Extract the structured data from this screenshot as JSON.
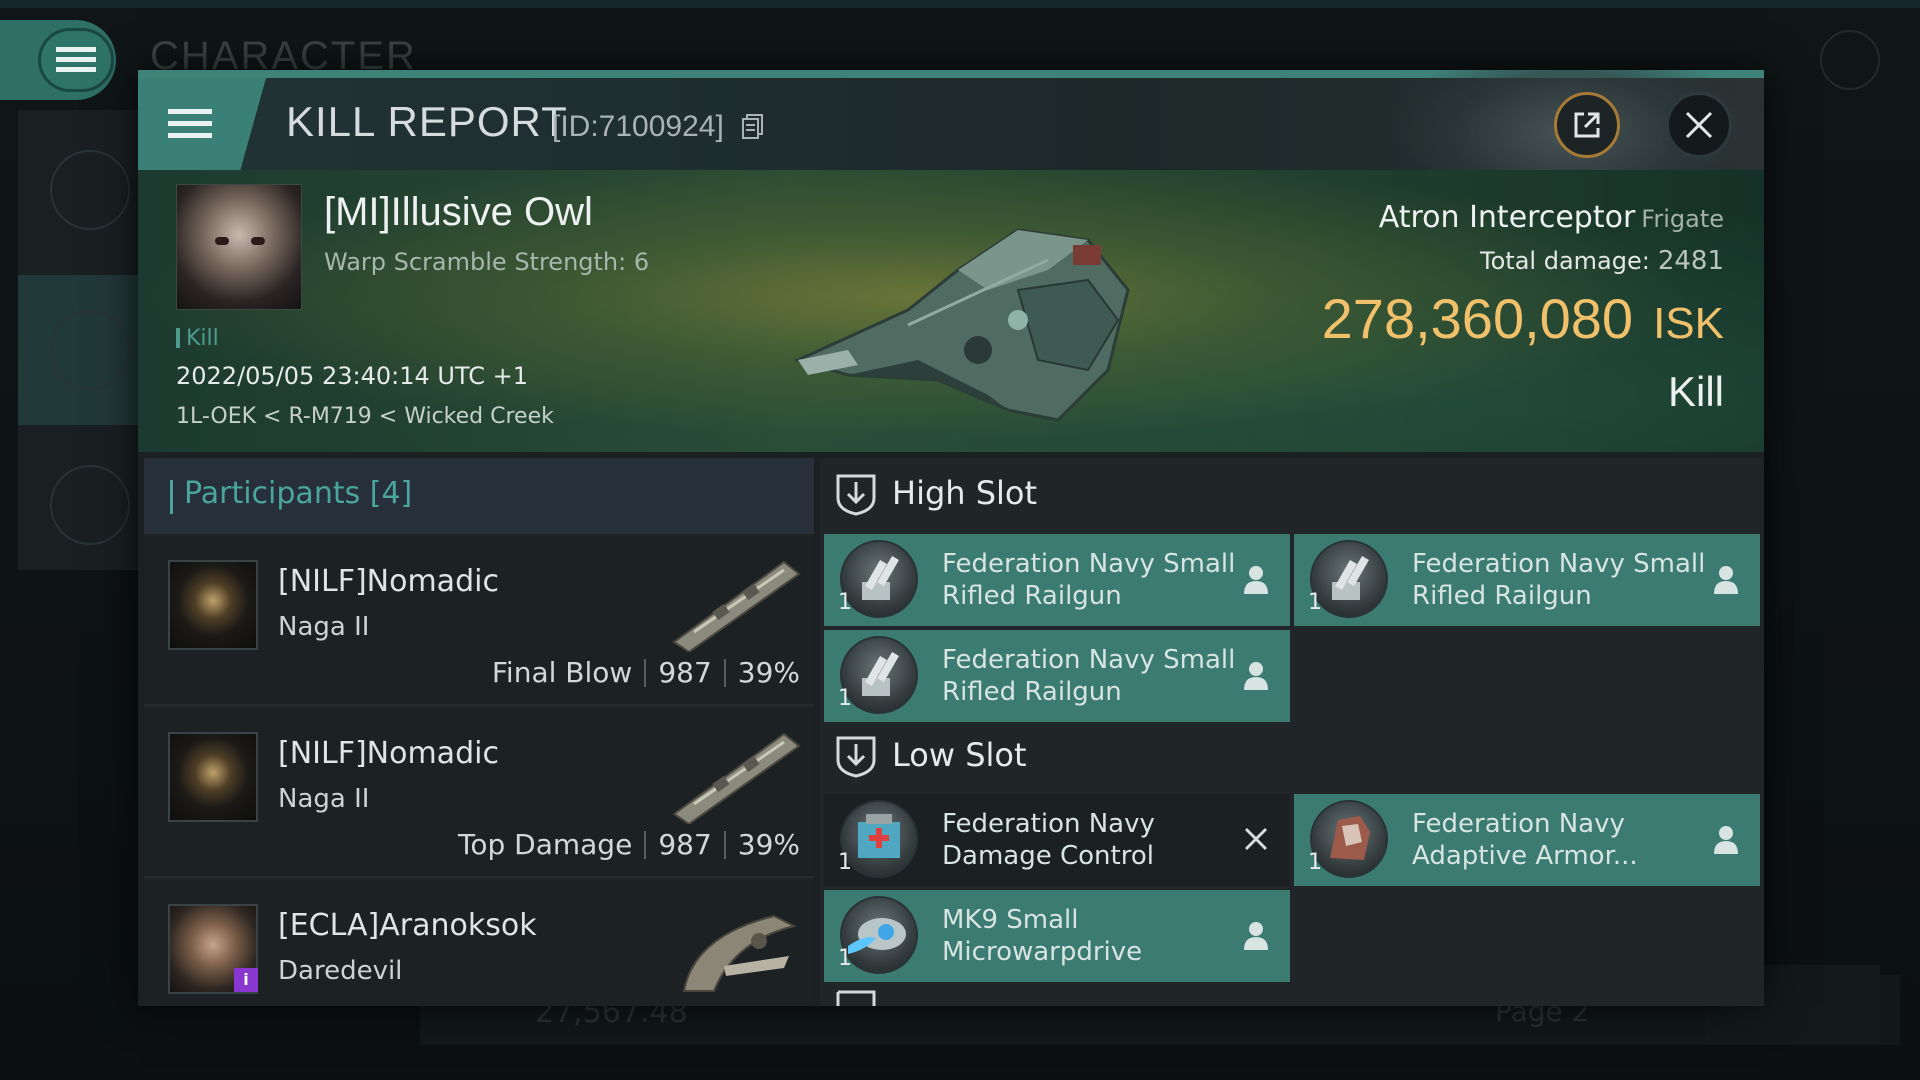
{
  "background": {
    "title": "CHARACTER",
    "bottom_text": "27,567.48",
    "page_label": "Page 2"
  },
  "header": {
    "title": "KILL REPORT",
    "id": "[ID:7100924]"
  },
  "victim": {
    "name": "[MI]Illusive Owl",
    "detail": "Warp Scramble Strength: 6",
    "kill_tag": "Kill",
    "datetime": "2022/05/05 23:40:14 UTC +1",
    "location": "1L-OEK < R-M719 < Wicked Creek",
    "ship_name": "Atron Interceptor",
    "ship_class": "Frigate",
    "damage_label": "Total damage:",
    "damage_value": "2481",
    "isk_value": "278,360,080",
    "isk_unit": "ISK",
    "result": "Kill"
  },
  "participants": {
    "title": "Participants [4]",
    "rows": [
      {
        "name": "[NILF]Nomadic",
        "ship": "Naga II",
        "role": "Final Blow",
        "damage": "987",
        "percent": "39%"
      },
      {
        "name": "[NILF]Nomadic",
        "ship": "Naga II",
        "role": "Top Damage",
        "damage": "987",
        "percent": "39%"
      },
      {
        "name": "[ECLA]Aranoksok",
        "ship": "Daredevil",
        "badge": "i"
      }
    ]
  },
  "slots": {
    "high": {
      "title": "High Slot",
      "modules": [
        {
          "qty": "1",
          "name": "Federation Navy Small Rifled Railgun",
          "status": "dropped"
        },
        {
          "qty": "1",
          "name": "Federation Navy Small Rifled Railgun",
          "status": "dropped"
        },
        {
          "qty": "1",
          "name": "Federation Navy Small Rifled Railgun",
          "status": "dropped"
        }
      ]
    },
    "low": {
      "title": "Low Slot",
      "modules": [
        {
          "qty": "1",
          "name": "Federation Navy Damage Control",
          "status": "destroyed"
        },
        {
          "qty": "1",
          "name": "Federation Navy Adaptive Armor...",
          "status": "dropped"
        },
        {
          "qty": "1",
          "name": "MK9 Small Microwarpdrive",
          "status": "dropped"
        }
      ]
    }
  },
  "colors": {
    "accent_teal": "#3b7b71",
    "isk_gold": "#f0c06a",
    "participants_title": "#4aa59a"
  },
  "icons": [
    "menu-icon",
    "copy-icon",
    "share-icon",
    "close-icon",
    "shield-icon",
    "person-icon",
    "x-icon",
    "railgun-icon",
    "damage-control-icon",
    "armor-icon",
    "microwarpdrive-icon"
  ]
}
